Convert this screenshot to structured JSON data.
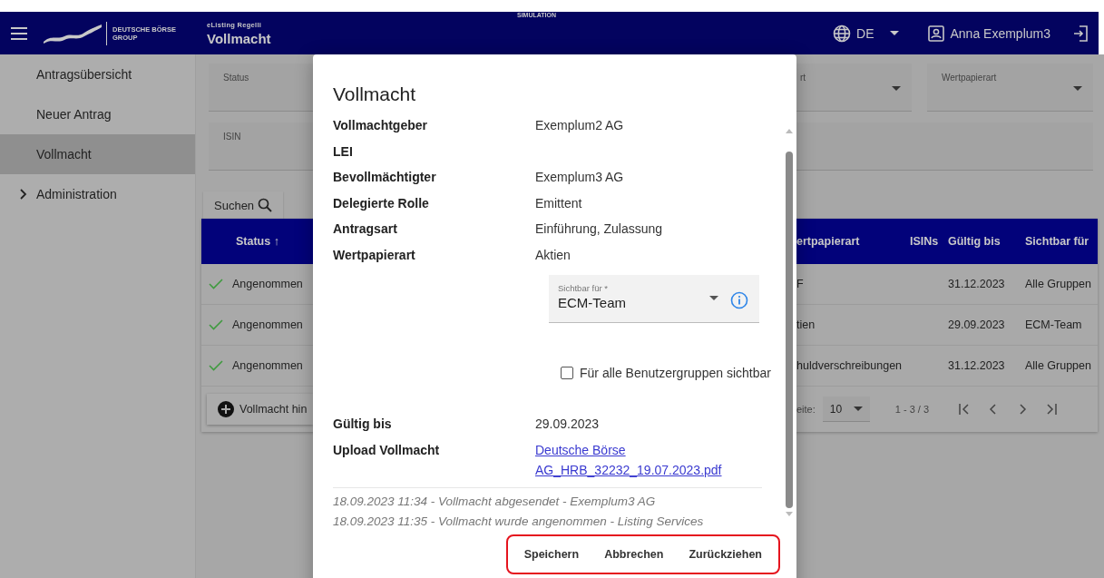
{
  "header": {
    "banner": "SIMULATION",
    "logo_text": [
      "DEUTSCHE BÖRSE",
      "GROUP"
    ],
    "app_name": "eListing Regelli",
    "title": "Vollmacht",
    "language": "DE",
    "user": "Anna Exemplum3"
  },
  "sidebar": {
    "items": [
      {
        "label": "Antragsübersicht",
        "kind": "link",
        "selected": false
      },
      {
        "label": "Neuer Antrag",
        "kind": "link",
        "selected": false
      },
      {
        "label": "Vollmacht",
        "kind": "link",
        "selected": true
      },
      {
        "label": "Administration",
        "kind": "group",
        "selected": false,
        "expanded": false
      }
    ]
  },
  "filters": [
    {
      "label": "Status",
      "kind": "text"
    },
    {
      "label": "rt",
      "kind": "select"
    },
    {
      "label": "Wertpapierart",
      "kind": "select"
    },
    {
      "label": "ISIN",
      "kind": "text"
    }
  ],
  "search_button": "Suchen",
  "table": {
    "columns": [
      {
        "label": "Status ↑"
      },
      {
        "label": "ertpapierart"
      },
      {
        "label": "ISINs"
      },
      {
        "label": "Gültig bis"
      },
      {
        "label": "Sichtbar für"
      }
    ],
    "rows": [
      {
        "status": "Angenommen",
        "column_2": "F",
        "valid_until": "31.12.2023",
        "visible_for": "Alle Gruppen"
      },
      {
        "status": "Angenommen",
        "column_2": "tien",
        "valid_until": "29.09.2023",
        "visible_for": "ECM-Team"
      },
      {
        "status": "Angenommen",
        "column_2": "huldverschreibungen",
        "valid_until": "31.12.2023",
        "visible_for": "Alle Gruppen"
      }
    ],
    "add_button": "Vollmacht hin",
    "page_size_label": "eite:",
    "page_size": "10",
    "range": "1 - 3 / 3"
  },
  "dialog": {
    "title": "Vollmacht",
    "details": [
      {
        "label": "Vollmachtgeber",
        "value": "Exemplum2 AG"
      },
      {
        "label": "LEI"
      },
      {
        "label": "Bevollmächtigter",
        "value": "Exemplum3 AG"
      },
      {
        "label": "Delegierte Rolle",
        "value": "Emittent"
      },
      {
        "label": "Antragsart",
        "value": "Einführung, Zulassung"
      },
      {
        "label": "Wertpapierart",
        "value": "Aktien"
      }
    ],
    "visibility_select": {
      "label": "Sichtbar für *",
      "value": "ECM-Team"
    },
    "all_groups_checkbox": {
      "label": "Für alle Benutzergruppen sichtbar",
      "checked": false
    },
    "details_2": [
      {
        "label": "Gültig bis",
        "value": "29.09.2023"
      },
      {
        "label": "Upload Vollmacht",
        "link": "Deutsche Börse AG_HRB_32232_19.07.2023.pdf"
      }
    ],
    "history": [
      "18.09.2023 11:34 - Vollmacht abgesendet - Exemplum3 AG",
      "18.09.2023 11:35 - Vollmacht wurde angenommen - Listing Services"
    ],
    "buttons": [
      "Speichern",
      "Abbrechen",
      "Zurückziehen"
    ],
    "buttons_highlighted": true
  }
}
